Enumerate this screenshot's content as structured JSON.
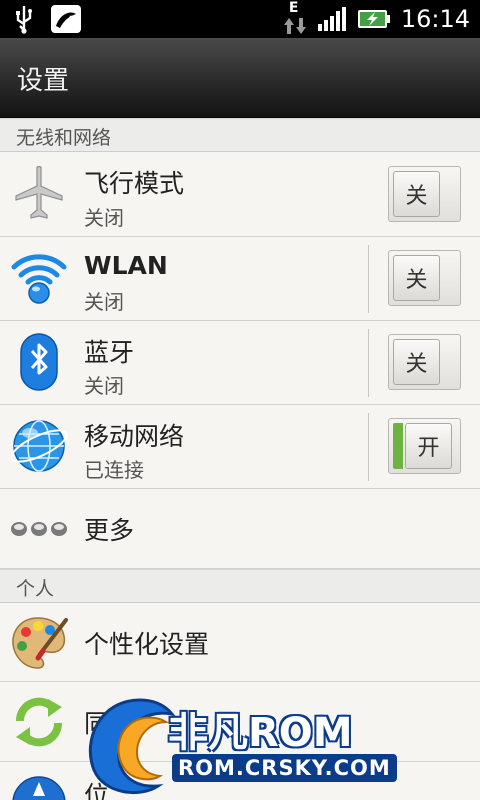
{
  "status_bar": {
    "clock": "16:14",
    "network_letter": "E",
    "icons": [
      "usb-icon",
      "app-notification-icon",
      "data-activity-icon",
      "signal-icon",
      "battery-charging-icon"
    ]
  },
  "header": {
    "title": "设置"
  },
  "sections": {
    "wireless": {
      "label": "无线和网络"
    },
    "personal": {
      "label": "个人"
    }
  },
  "rows": {
    "airplane": {
      "title": "飞行模式",
      "subtitle": "关闭",
      "toggle": "关",
      "icon": "airplane-icon"
    },
    "wlan": {
      "title": "WLAN",
      "subtitle": "关闭",
      "toggle": "关",
      "icon": "wifi-icon"
    },
    "bluetooth": {
      "title": "蓝牙",
      "subtitle": "关闭",
      "toggle": "关",
      "icon": "bluetooth-icon"
    },
    "mobile": {
      "title": "移动网络",
      "subtitle": "已连接",
      "toggle": "开",
      "icon": "globe-icon"
    },
    "more": {
      "title": "更多",
      "icon": "more-dots-icon"
    },
    "personalize": {
      "title": "个性化设置",
      "icon": "palette-icon"
    },
    "sync": {
      "title": "同",
      "icon": "sync-icon"
    },
    "location": {
      "title": "位",
      "icon": "location-icon"
    }
  },
  "watermark": {
    "brand": "非凡ROM",
    "url": "ROM.CRSKY.COM"
  },
  "colors": {
    "toggle_on": "#6db33f",
    "titlebar": "#2b2b2b",
    "accent_blue": "#1e88e5"
  }
}
